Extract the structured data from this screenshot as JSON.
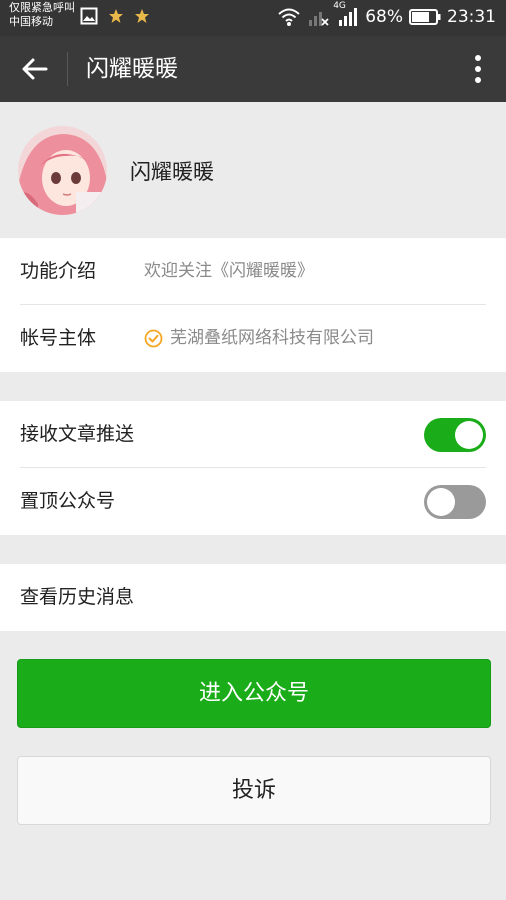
{
  "statusbar": {
    "carrier_line1": "仅限紧急呼叫",
    "carrier_line2": "中国移动",
    "network": "4G",
    "battery": "68%",
    "time": "23:31",
    "icons": [
      "image-icon",
      "star-icon",
      "star-icon",
      "wifi-icon",
      "signal-off-icon",
      "signal-icon",
      "battery-icon"
    ]
  },
  "appbar": {
    "title": "闪耀暖暖",
    "back_icon": "arrow-left-icon",
    "more_icon": "more-vertical-icon"
  },
  "profile": {
    "name": "闪耀暖暖"
  },
  "info": {
    "intro_label": "功能介绍",
    "intro_value": "欢迎关注《闪耀暖暖》",
    "owner_label": "帐号主体",
    "owner_value": "芜湖叠纸网络科技有限公司"
  },
  "settings": {
    "receive_label": "接收文章推送",
    "receive_on": true,
    "pin_label": "置顶公众号",
    "pin_on": false
  },
  "history": {
    "label": "查看历史消息"
  },
  "actions": {
    "enter_label": "进入公众号",
    "complain_label": "投诉"
  },
  "colors": {
    "accent": "#1aad19",
    "toolbar": "#3a3a3a",
    "background": "#ebebeb",
    "verified": "#f5a623"
  }
}
